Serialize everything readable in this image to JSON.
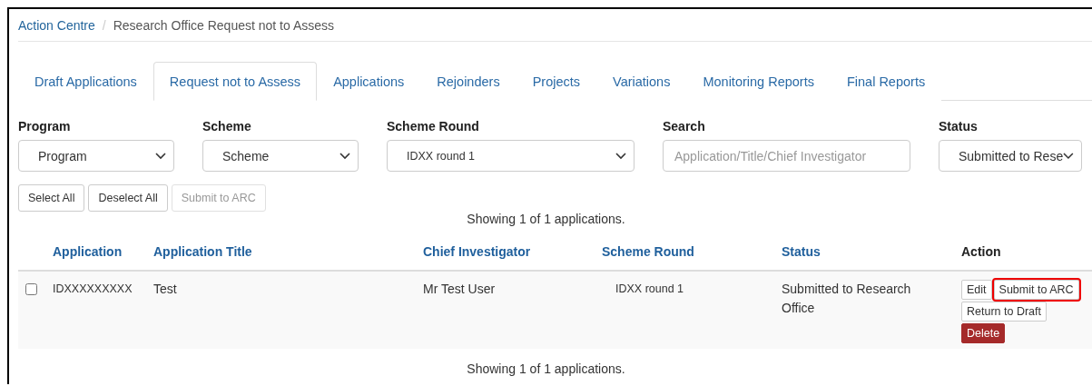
{
  "breadcrumb_separator": "/",
  "breadcrumb": [
    {
      "label": "Action Centre",
      "link": true
    },
    {
      "label": "Research Office Request not to Assess",
      "link": false
    }
  ],
  "tabs": [
    {
      "label": "Draft Applications",
      "selected": false
    },
    {
      "label": "Request not to Assess",
      "selected": true
    },
    {
      "label": "Applications",
      "selected": false
    },
    {
      "label": "Rejoinders",
      "selected": false
    },
    {
      "label": "Projects",
      "selected": false
    },
    {
      "label": "Variations",
      "selected": false
    },
    {
      "label": "Monitoring Reports",
      "selected": false
    },
    {
      "label": "Final Reports",
      "selected": false
    }
  ],
  "filters": [
    {
      "kind": "select",
      "label": "Program",
      "value": "Program"
    },
    {
      "kind": "select",
      "label": "Scheme",
      "value": "Scheme"
    },
    {
      "kind": "select",
      "label": "Scheme Round",
      "value": "IDXX round 1"
    },
    {
      "kind": "input",
      "label": "Search",
      "placeholder": "Application/Title/Chief Investigator"
    },
    {
      "kind": "select",
      "label": "Status",
      "value": "Submitted to Rese"
    }
  ],
  "bulk_buttons": [
    {
      "label": "Select All",
      "disabled": false
    },
    {
      "label": "Deselect All",
      "disabled": false
    },
    {
      "label": "Submit to ARC",
      "disabled": true
    }
  ],
  "summary_top": "Showing 1 of 1 applications.",
  "table": {
    "columns": [
      "Application",
      "Application Title",
      "Chief Investigator",
      "Scheme Round",
      "Status",
      "Action"
    ],
    "rows": [
      {
        "checked": false,
        "application": "IDXXXXXXXXX",
        "title": "Test",
        "chief_investigator": "Mr Test User",
        "scheme_round": "IDXX round 1",
        "status": "Submitted to Research Office",
        "actions": [
          {
            "label": "Edit",
            "kind": "default",
            "highlighted": false
          },
          {
            "label": "Submit to ARC",
            "kind": "default",
            "highlighted": true
          },
          {
            "label": "Return to Draft",
            "kind": "default",
            "highlighted": false
          },
          {
            "label": "Delete",
            "kind": "danger",
            "highlighted": false
          }
        ]
      }
    ]
  },
  "summary_bottom": "Showing 1 of 1 applications."
}
